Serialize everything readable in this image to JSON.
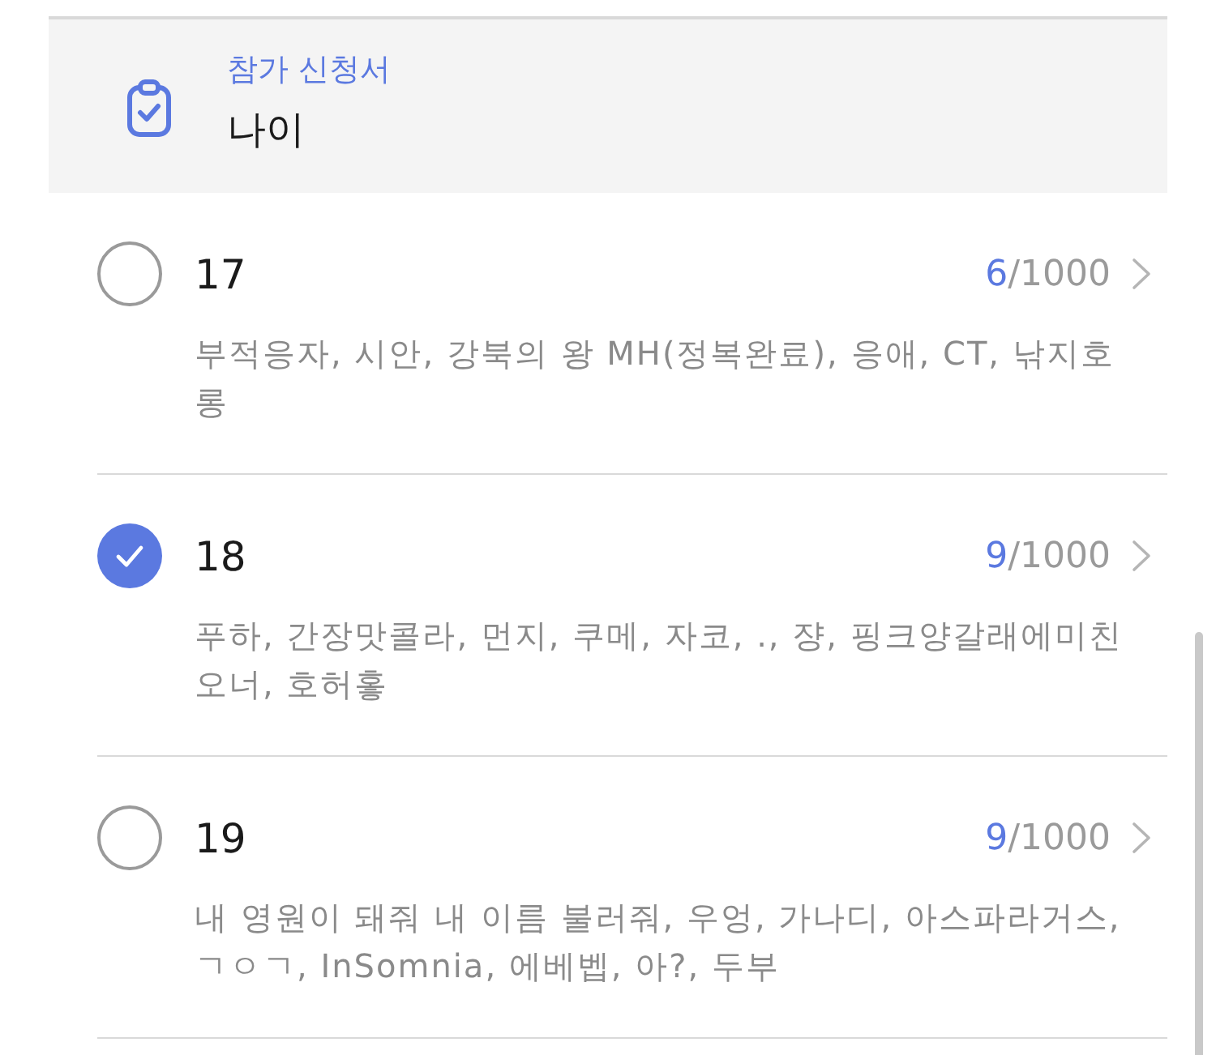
{
  "header": {
    "category": "참가 신청서",
    "title": "나이"
  },
  "options": [
    {
      "label": "17",
      "selected": false,
      "count": "6",
      "limit": "/1000",
      "names": "부적응자, 시안, 강북의 왕 MH(정복완료), 응애, CT, 낚지호롱"
    },
    {
      "label": "18",
      "selected": true,
      "count": "9",
      "limit": "/1000",
      "names": "푸하, 간장맛콜라, 먼지, 쿠메, 자코, ., 쟝, 핑크양갈래에미친오너, 호허홓"
    },
    {
      "label": "19",
      "selected": false,
      "count": "9",
      "limit": "/1000",
      "names": "내 영원이 돼줘 내 이름 불러줘, 우엉, 가나디, 아스파라거스, ㄱㅇㄱ, InSomnia, 에베벱, 아?, 두부"
    }
  ]
}
